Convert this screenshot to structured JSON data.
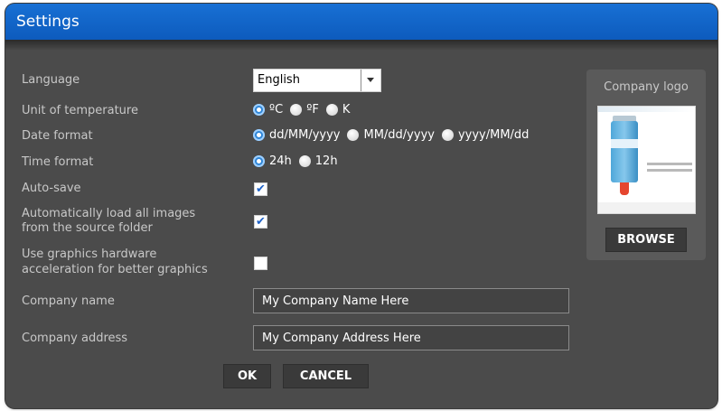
{
  "dialog": {
    "title": "Settings"
  },
  "labels": {
    "language": "Language",
    "unit": "Unit of temperature",
    "date": "Date format",
    "time": "Time format",
    "autosave": "Auto-save",
    "autoload_line1": "Automatically load all images",
    "autoload_line2": "from the source folder",
    "hw_line1": "Use graphics hardware",
    "hw_line2": "acceleration for better graphics",
    "company_name": "Company name",
    "company_address": "Company address"
  },
  "language": {
    "selected": "English"
  },
  "unit_options": [
    "ºC",
    "ºF",
    "K"
  ],
  "unit_selected": "ºC",
  "date_options": [
    "dd/MM/yyyy",
    "MM/dd/yyyy",
    "yyyy/MM/dd"
  ],
  "date_selected": "dd/MM/yyyy",
  "time_options": [
    "24h",
    "12h"
  ],
  "time_selected": "24h",
  "checkboxes": {
    "autosave": true,
    "autoload": true,
    "hardware_acceleration": false
  },
  "fields": {
    "company_name": "My Company Name Here",
    "company_address": "My Company Address Here"
  },
  "logo_panel": {
    "title": "Company logo",
    "browse_label": "BROWSE"
  },
  "buttons": {
    "ok": "OK",
    "cancel": "CANCEL"
  },
  "colors": {
    "titlebar": "#0f63c8",
    "background": "#4b4b4b",
    "accent": "#2f86d8"
  },
  "icons": {
    "check": "check-icon",
    "dropdown": "chevron-down-icon"
  }
}
